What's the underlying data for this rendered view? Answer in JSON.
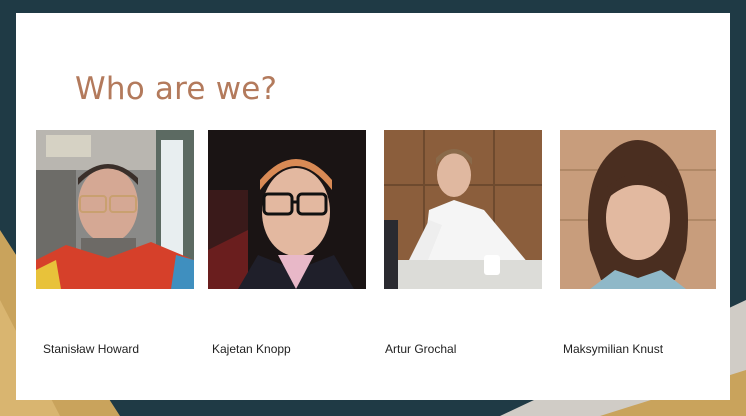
{
  "slide": {
    "title": "Who are we?"
  },
  "team": [
    {
      "name": "Stanisław Howard"
    },
    {
      "name": "Kajetan Knopp"
    },
    {
      "name": "Artur Grochal"
    },
    {
      "name": "Maksymilian Knust"
    }
  ]
}
